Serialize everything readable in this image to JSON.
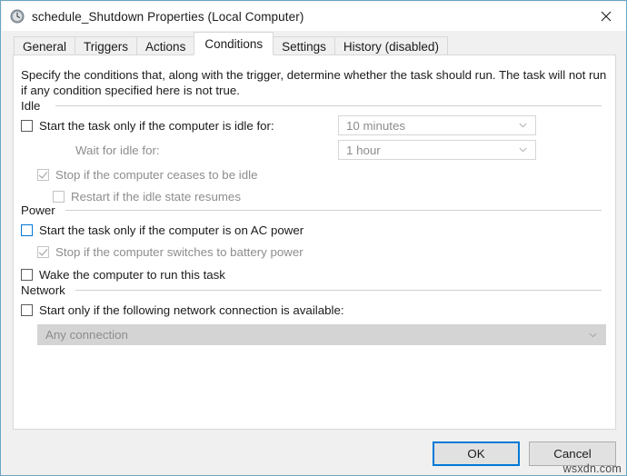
{
  "window": {
    "title": "schedule_Shutdown Properties (Local Computer)",
    "title_icon": "clock-icon",
    "close_label": "✕",
    "accent_color": "#0078d7",
    "border_color": "#6ba6c4"
  },
  "tabs": [
    {
      "label": "General",
      "active": false
    },
    {
      "label": "Triggers",
      "active": false
    },
    {
      "label": "Actions",
      "active": false
    },
    {
      "label": "Conditions",
      "active": true
    },
    {
      "label": "Settings",
      "active": false
    },
    {
      "label": "History (disabled)",
      "active": false
    }
  ],
  "panel": {
    "description": "Specify the conditions that, along with the trigger, determine whether the task should run.  The task will not run  if any condition specified here is not true."
  },
  "groups": {
    "idle": {
      "label": "Idle",
      "start_if_idle": {
        "label": "Start the task only if the computer is idle for:",
        "checked": false,
        "state": "enabled"
      },
      "idle_duration": {
        "value": "10 minutes",
        "state": "disabled"
      },
      "wait_for_idle_label": "Wait for idle for:",
      "wait_duration": {
        "value": "1 hour",
        "state": "disabled"
      },
      "stop_if_ceases_idle": {
        "label": "Stop if the computer ceases to be idle",
        "checked": true,
        "state": "disabled"
      },
      "restart_if_idle_resumes": {
        "label": "Restart if the idle state resumes",
        "checked": false,
        "state": "disabled"
      }
    },
    "power": {
      "label": "Power",
      "start_if_ac": {
        "label": "Start the task only if the computer is on AC power",
        "checked": false,
        "state": "hover"
      },
      "stop_if_battery": {
        "label": "Stop if the computer switches to battery power",
        "checked": true,
        "state": "disabled"
      },
      "wake_computer": {
        "label": "Wake the computer to run this task",
        "checked": false,
        "state": "enabled"
      }
    },
    "network": {
      "label": "Network",
      "start_if_network": {
        "label": "Start only if the following network connection is available:",
        "checked": false,
        "state": "enabled"
      },
      "connection": {
        "value": "Any connection",
        "state": "disabled"
      }
    }
  },
  "footer": {
    "ok_label": "OK",
    "cancel_label": "Cancel"
  },
  "watermark": "wsxdn.com"
}
